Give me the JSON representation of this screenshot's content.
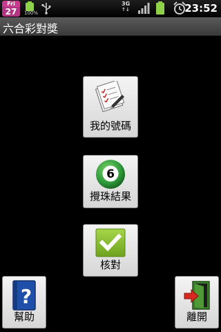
{
  "status_bar": {
    "calendar_day": "Fri",
    "calendar_date": "27",
    "battery_percent": "100%",
    "network": "3G",
    "time": "23:52",
    "icons": [
      "calendar-icon",
      "battery-icon",
      "usb-icon",
      "3g-icon",
      "signal-icon",
      "battery-icon",
      "alarm-icon"
    ]
  },
  "app": {
    "title": "六合彩對獎"
  },
  "buttons": {
    "my_numbers": {
      "label": "我的號碼",
      "icon": "checklist-icon"
    },
    "draw_results": {
      "label": "攪珠結果",
      "icon": "lottery-ball-icon",
      "ball_number": "6"
    },
    "check": {
      "label": "核對",
      "icon": "checkmark-icon"
    },
    "help": {
      "label": "幫助",
      "icon": "help-book-icon"
    },
    "exit": {
      "label": "離開",
      "icon": "exit-door-icon"
    }
  },
  "colors": {
    "background": "#000000",
    "titlebar": "#4a4a4a",
    "button": "#e6e6e6",
    "check_green": "#7fb62a",
    "ball_green": "#2e9a3a"
  }
}
